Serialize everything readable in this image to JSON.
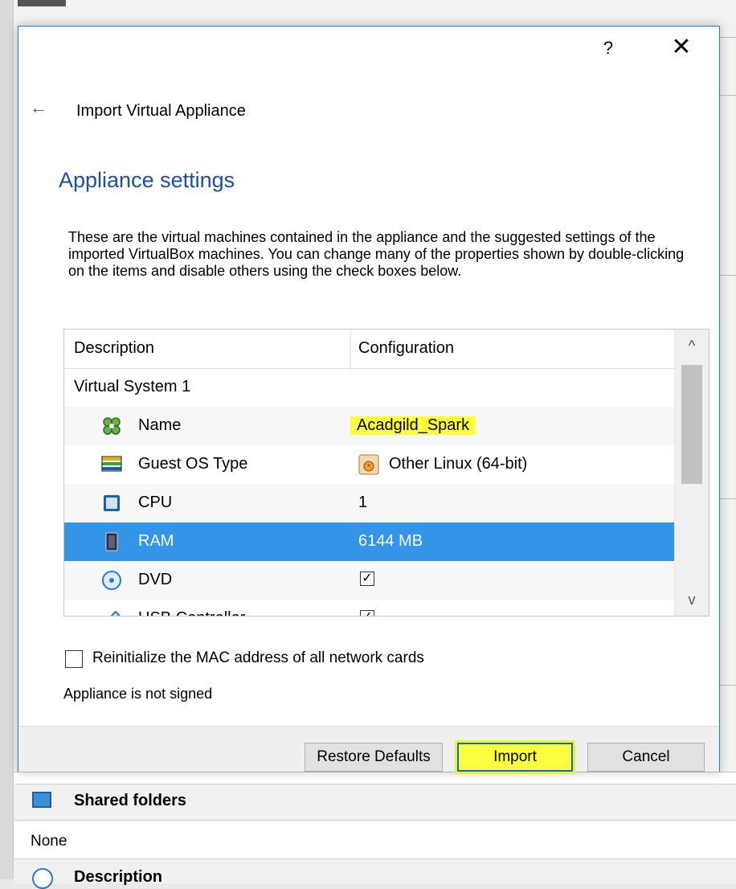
{
  "background": {
    "shared_folders_title": "Shared folders",
    "shared_folders_value": "None",
    "description_title": "Description"
  },
  "dialog": {
    "help_label": "?",
    "close_label": "✕",
    "back_arrow": "←",
    "wizard_title": "Import Virtual Appliance",
    "page_heading": "Appliance settings",
    "description": "These are the virtual machines contained in the appliance and the suggested settings of the imported VirtualBox machines. You can change many of the properties shown by double-clicking on the items and disable others using the check boxes below."
  },
  "table": {
    "headers": [
      "Description",
      "Configuration"
    ],
    "group_label": "Virtual System 1",
    "rows": [
      {
        "label": "Name",
        "value": "Acadgild_Spark",
        "icon": "name-icon"
      },
      {
        "label": "Guest OS Type",
        "value": "Other Linux (64-bit)",
        "icon": "guest-os-icon"
      },
      {
        "label": "CPU",
        "value": "1",
        "icon": "cpu-icon"
      },
      {
        "label": "RAM",
        "value": "6144 MB",
        "icon": "ram-icon"
      },
      {
        "label": "DVD",
        "value": "",
        "icon": "dvd-icon",
        "checked": true
      },
      {
        "label": "USB Controller",
        "value": "",
        "icon": "usb-icon",
        "checked": true
      }
    ],
    "scroll_up": "^",
    "scroll_down": "v"
  },
  "options": {
    "mac_label": "Reinitialize the MAC address of all network cards",
    "mac_checked": false,
    "signature_status": "Appliance is not signed"
  },
  "buttons": {
    "restore_defaults": "Restore Defaults",
    "import": "Import",
    "cancel": "Cancel"
  },
  "colors": {
    "heading": "#1e4e9c",
    "selection": "#3394e8",
    "highlight": "#fcff40",
    "accent_border": "#2d7ad6"
  }
}
